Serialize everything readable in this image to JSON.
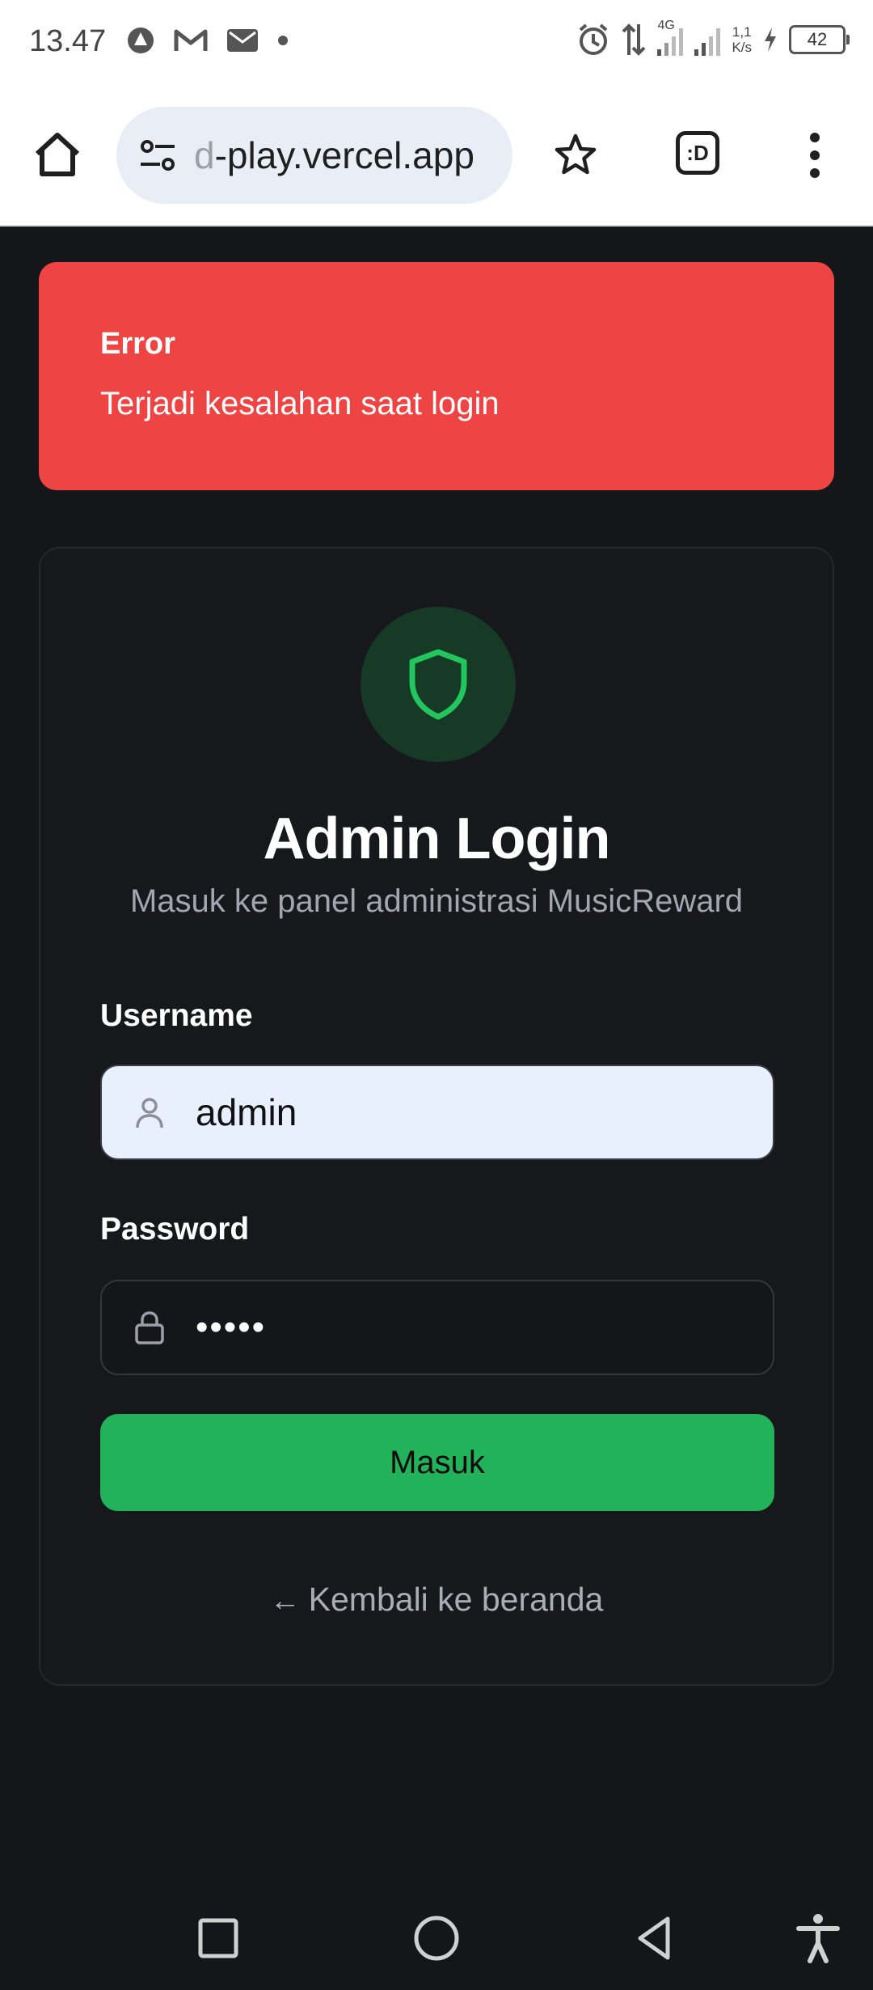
{
  "status_bar": {
    "time": "13.47",
    "icons_left": [
      "vpn-icon",
      "gmail-icon",
      "email-icon",
      "dot-icon"
    ],
    "network": "4G",
    "speed_top": "1,1",
    "speed_bottom": "K/s",
    "battery": "42"
  },
  "browser": {
    "url": "d-play.vercel.app",
    "tabs_label": ":D"
  },
  "error": {
    "title": "Error",
    "message": "Terjadi kesalahan saat login",
    "color": "#ef4444"
  },
  "login": {
    "title": "Admin Login",
    "subtitle": "Masuk ke panel administrasi MusicReward",
    "username_label": "Username",
    "username_value": "admin",
    "password_label": "Password",
    "password_value": "•••••",
    "submit_label": "Masuk",
    "back_arrow": "←",
    "back_label": "Kembali ke beranda",
    "accent_color": "#22b35a"
  }
}
